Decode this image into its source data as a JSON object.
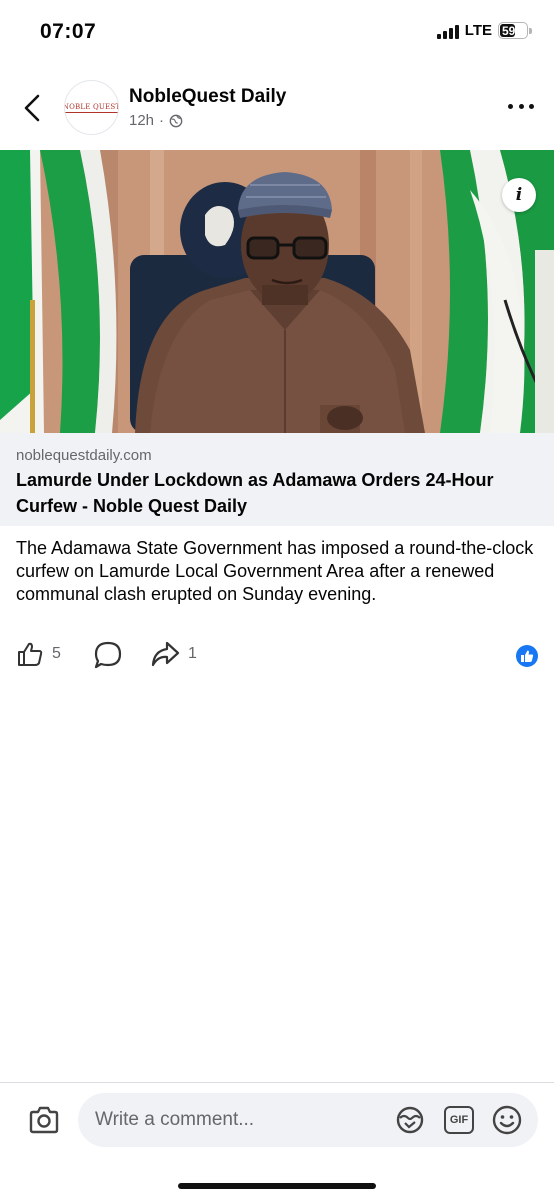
{
  "status_bar": {
    "time": "07:07",
    "network": "LTE",
    "battery": "59"
  },
  "post": {
    "page_name": "NobleQuest Daily",
    "avatar_text": "NOBLE QUEST",
    "time_ago": "12h",
    "separator": "·",
    "audience_icon": "globe-icon"
  },
  "link_preview": {
    "domain": "noblequestdaily.com",
    "title": "Lamurde Under Lockdown as Adamawa Orders 24-Hour Curfew - Noble Quest Daily",
    "info_label": "i"
  },
  "caption": "The Adamawa State Government has imposed a round-the-clock curfew on Lamurde Local Government Area after a renewed communal clash erupted on Sunday evening.",
  "actions": {
    "like_count": "5",
    "share_count": "1"
  },
  "comment_bar": {
    "placeholder": "Write a comment...",
    "gif_label": "GIF"
  },
  "colors": {
    "accent": "#1877f2",
    "secondary_text": "#65676b",
    "card_background": "#f0f2f5"
  }
}
